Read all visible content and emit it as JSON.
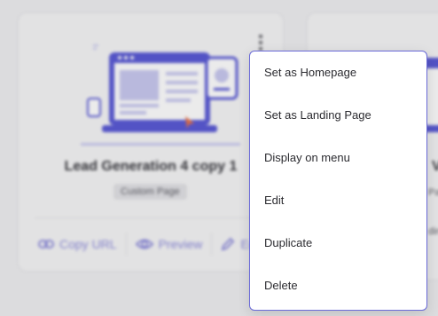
{
  "card": {
    "title": "Lead Generation 4 copy 1",
    "badge": "Custom Page",
    "actions": {
      "copy_url": "Copy URL",
      "preview": "Preview",
      "edit": "Edit"
    }
  },
  "side_card": {
    "title": "Vi",
    "badge": "Pa",
    "line": "din"
  },
  "menu": {
    "items": [
      "Set as Homepage",
      "Set as Landing Page",
      "Display on menu",
      "Edit",
      "Duplicate",
      "Delete"
    ]
  },
  "colors": {
    "accent": "#5b5bd6",
    "menu_border": "#6a6ad8",
    "action_text": "#8e8cdc"
  },
  "icons": [
    "kebab-menu-icon",
    "link-icon",
    "eye-icon",
    "pencil-icon"
  ]
}
